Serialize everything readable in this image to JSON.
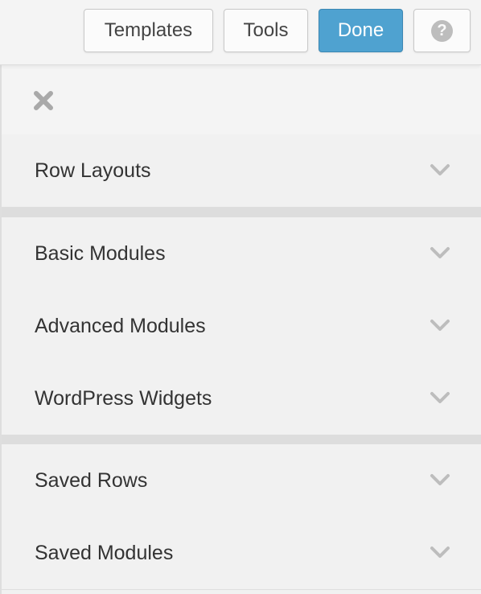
{
  "toolbar": {
    "templates_label": "Templates",
    "tools_label": "Tools",
    "done_label": "Done",
    "help_label": "?",
    "done_color": "#4fa2d0"
  },
  "panel": {
    "close_icon": "close-icon",
    "sections": [
      {
        "label": "Row Layouts",
        "icon": "chevron-down-icon"
      },
      {
        "label": "Basic Modules",
        "icon": "chevron-down-icon"
      },
      {
        "label": "Advanced Modules",
        "icon": "chevron-down-icon"
      },
      {
        "label": "WordPress Widgets",
        "icon": "chevron-down-icon"
      },
      {
        "label": "Saved Rows",
        "icon": "chevron-down-icon"
      },
      {
        "label": "Saved Modules",
        "icon": "chevron-down-icon"
      }
    ]
  }
}
